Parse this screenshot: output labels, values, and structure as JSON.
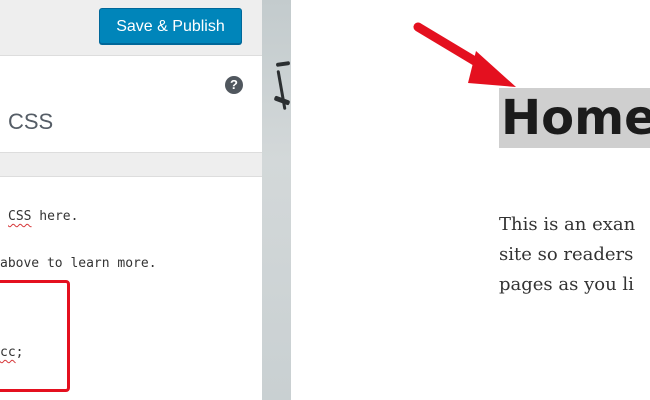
{
  "topbar": {
    "publish_label": "Save & Publish"
  },
  "section": {
    "title": "CSS",
    "help_glyph": "?"
  },
  "editor": {
    "line1_prefix": "",
    "line1_word": "CSS",
    "line1_suffix": " here.",
    "line2": "above to learn more.",
    "line3_word": "cc",
    "line3_suffix": ";"
  },
  "preview": {
    "heading": "Home",
    "body_lines": [
      "This is an exan",
      "site so readers",
      "pages as you li"
    ]
  },
  "colors": {
    "publish_button": "#0085ba",
    "annotation_red": "#e4101f",
    "title_highlight": "#cfcfcf"
  },
  "icons": {
    "help": "question-mark-circle-icon",
    "pointer": "red-arrow-annotation-icon"
  }
}
